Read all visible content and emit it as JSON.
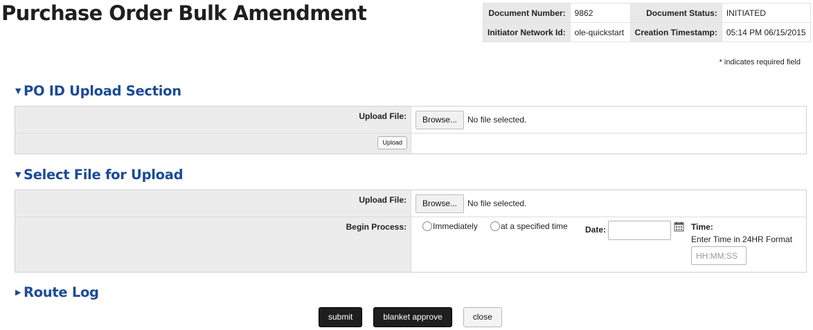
{
  "page": {
    "title": "Purchase Order Bulk Amendment"
  },
  "doc_header": {
    "number_label": "Document Number:",
    "number_value": "9862",
    "status_label": "Document Status:",
    "status_value": "INITIATED",
    "initiator_label": "Initiator Network Id:",
    "initiator_value": "ole-quickstart",
    "timestamp_label": "Creation Timestamp:",
    "timestamp_value": "05:14 PM 06/15/2015"
  },
  "required_note": "* indicates required field",
  "po_upload": {
    "title": "PO ID Upload Section",
    "upload_label": "Upload File:",
    "browse_label": "Browse...",
    "file_status": "No file selected.",
    "upload_button": "Upload"
  },
  "select_file": {
    "title": "Select File for Upload",
    "upload_label": "Upload File:",
    "browse_label": "Browse...",
    "file_status": "No file selected.",
    "begin_label": "Begin Process:",
    "option_immediately": "Immediately",
    "option_specified": "at a specified time",
    "date_label": "Date:",
    "time_label": "Time:",
    "time_hint": "Enter Time in 24HR Format",
    "time_placeholder": "HH:MM:SS"
  },
  "route_log": {
    "title": "Route Log"
  },
  "actions": {
    "submit": "submit",
    "blanket_approve": "blanket approve",
    "close": "close"
  },
  "colors": {
    "section_heading": "#1b4b97",
    "label_background": "#ececec",
    "dark_button": "#1e1e1e"
  },
  "icons": {
    "collapse": "triangle-down-icon",
    "expand": "triangle-right-icon",
    "calendar": "calendar-icon"
  }
}
